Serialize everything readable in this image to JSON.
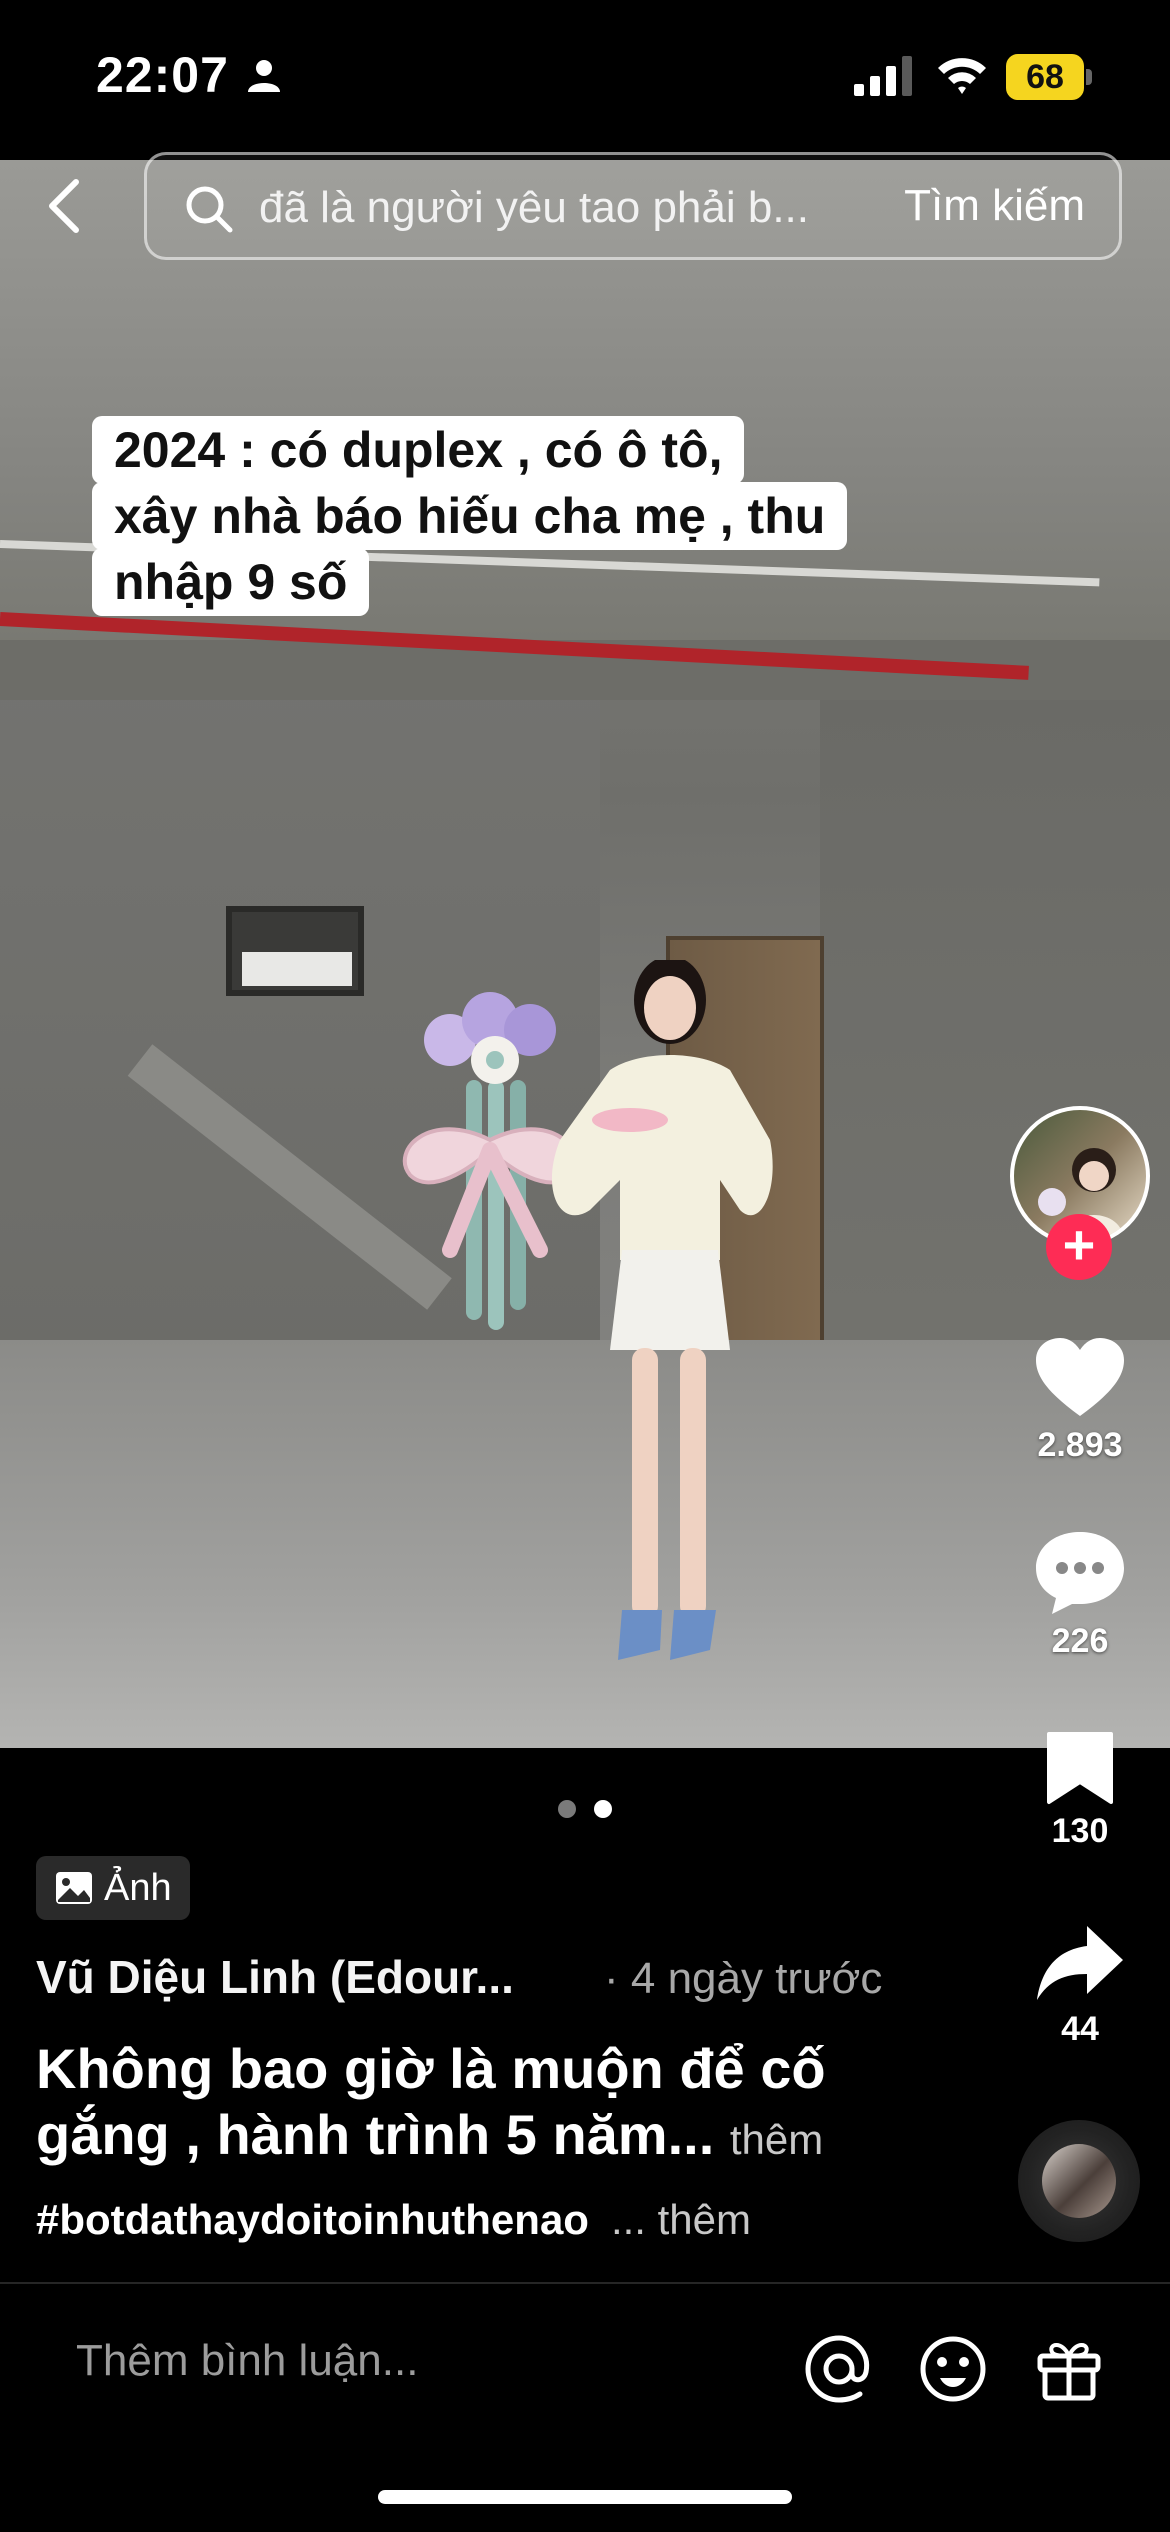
{
  "status_bar": {
    "time": "22:07",
    "battery": "68",
    "battery_color": "#f5d51f"
  },
  "search": {
    "query": "đã là người yêu tao phải b...",
    "button_label": "Tìm kiếm"
  },
  "photo": {
    "caption_lines": [
      "2024 : có duplex , có ô tô,",
      "xây nhà báo hiếu cha mẹ , thu",
      " nhập 9 số"
    ]
  },
  "actions": {
    "follow_symbol": "+",
    "likes": "2.893",
    "comments": "226",
    "saves": "130",
    "shares": "44",
    "accent_color": "#fe2c55"
  },
  "carousel": {
    "total": 2,
    "active_index": 1
  },
  "post": {
    "type_label": "Ảnh",
    "author": "Vũ Diệu Linh (Edour...",
    "time": "· 4 ngày trước",
    "title": "Không bao giờ là muộn để cố gắng , hành trình 5 năm...",
    "title_more": "thêm",
    "hashtag": "#botdathaydoitoinhuthenao",
    "hashtag_more": "... thêm"
  },
  "comment_bar": {
    "placeholder": "Thêm bình luận..."
  },
  "icons": {
    "back": "chevron-left-icon",
    "search": "search-icon",
    "like": "heart-icon",
    "comment": "comment-bubble-icon",
    "save": "bookmark-icon",
    "share": "share-arrow-icon",
    "mention": "at-sign-icon",
    "emoji": "smiley-icon",
    "gift": "gift-icon",
    "photo_badge": "image-icon"
  }
}
